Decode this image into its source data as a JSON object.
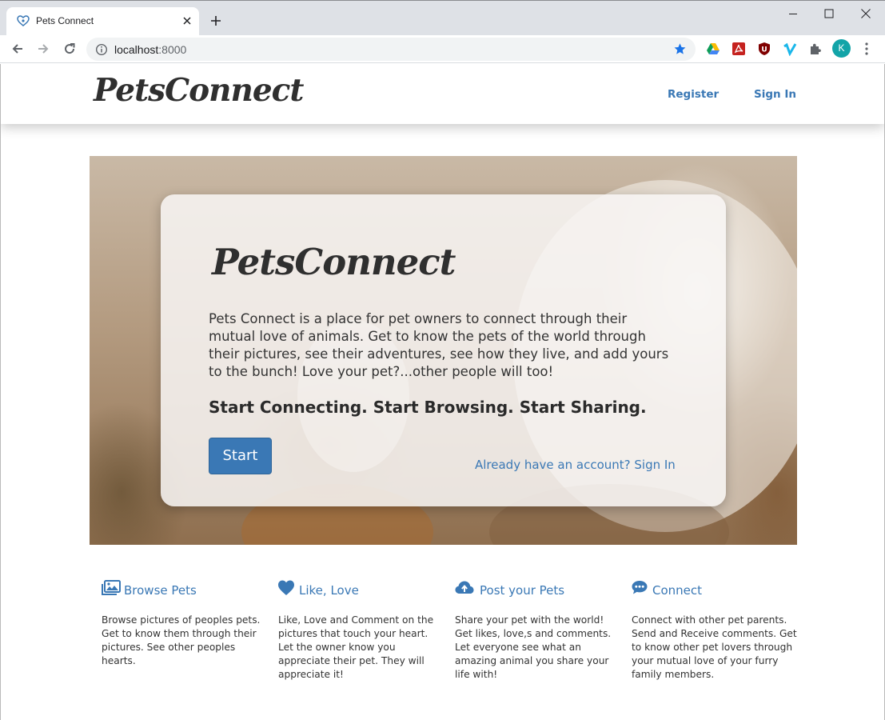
{
  "browser": {
    "tab_title": "Pets Connect",
    "url_host": "localhost",
    "url_port": ":8000",
    "profile_initial": "K"
  },
  "header": {
    "logo": "PetsConnect",
    "nav": [
      {
        "label": "Register"
      },
      {
        "label": "Sign In"
      }
    ]
  },
  "hero": {
    "logo": "PetsConnect",
    "description": "Pets Connect is a place for pet owners to connect through their mutual love of animals. Get to know the pets of the world through their pictures, see their adventures, see how they live, and add yours to the bunch! Love your pet?...other people will too!",
    "tagline": "Start Connecting. Start Browsing. Start Sharing.",
    "start_label": "Start",
    "signin_link": "Already have an account? Sign In"
  },
  "features": [
    {
      "icon": "image-icon",
      "title": "Browse Pets",
      "text": "Browse pictures of peoples pets. Get to know them through their pictures. See other peoples hearts."
    },
    {
      "icon": "heart-icon",
      "title": "Like, Love",
      "text": "Like, Love and Comment on the pictures that touch your heart. Let the owner know you appreciate their pet. They will appreciate it!"
    },
    {
      "icon": "cloud-upload-icon",
      "title": "Post your Pets",
      "text": "Share your pet with the world! Get likes, love,s and comments. Let everyone see what an amazing animal you share your life with!"
    },
    {
      "icon": "chat-icon",
      "title": "Connect",
      "text": "Connect with other pet parents. Send and Receive comments. Get to know other pet lovers through your mutual love of your furry family members."
    }
  ],
  "colors": {
    "accent": "#3a78b5",
    "text": "#333333",
    "avatar": "#12a4a8"
  }
}
